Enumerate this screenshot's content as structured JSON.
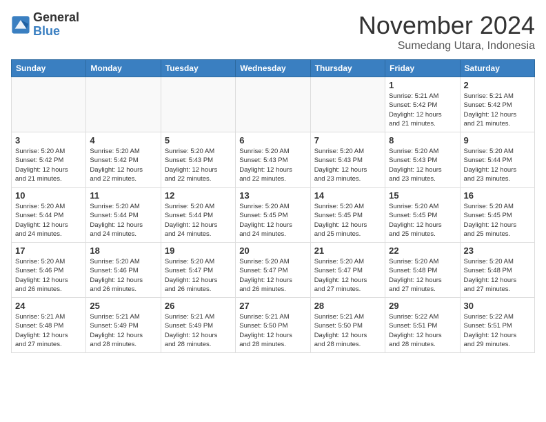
{
  "header": {
    "logo_line1": "General",
    "logo_line2": "Blue",
    "month": "November 2024",
    "location": "Sumedang Utara, Indonesia"
  },
  "days_of_week": [
    "Sunday",
    "Monday",
    "Tuesday",
    "Wednesday",
    "Thursday",
    "Friday",
    "Saturday"
  ],
  "weeks": [
    [
      {
        "day": "",
        "info": ""
      },
      {
        "day": "",
        "info": ""
      },
      {
        "day": "",
        "info": ""
      },
      {
        "day": "",
        "info": ""
      },
      {
        "day": "",
        "info": ""
      },
      {
        "day": "1",
        "info": "Sunrise: 5:21 AM\nSunset: 5:42 PM\nDaylight: 12 hours\nand 21 minutes."
      },
      {
        "day": "2",
        "info": "Sunrise: 5:21 AM\nSunset: 5:42 PM\nDaylight: 12 hours\nand 21 minutes."
      }
    ],
    [
      {
        "day": "3",
        "info": "Sunrise: 5:20 AM\nSunset: 5:42 PM\nDaylight: 12 hours\nand 21 minutes."
      },
      {
        "day": "4",
        "info": "Sunrise: 5:20 AM\nSunset: 5:42 PM\nDaylight: 12 hours\nand 22 minutes."
      },
      {
        "day": "5",
        "info": "Sunrise: 5:20 AM\nSunset: 5:43 PM\nDaylight: 12 hours\nand 22 minutes."
      },
      {
        "day": "6",
        "info": "Sunrise: 5:20 AM\nSunset: 5:43 PM\nDaylight: 12 hours\nand 22 minutes."
      },
      {
        "day": "7",
        "info": "Sunrise: 5:20 AM\nSunset: 5:43 PM\nDaylight: 12 hours\nand 23 minutes."
      },
      {
        "day": "8",
        "info": "Sunrise: 5:20 AM\nSunset: 5:43 PM\nDaylight: 12 hours\nand 23 minutes."
      },
      {
        "day": "9",
        "info": "Sunrise: 5:20 AM\nSunset: 5:44 PM\nDaylight: 12 hours\nand 23 minutes."
      }
    ],
    [
      {
        "day": "10",
        "info": "Sunrise: 5:20 AM\nSunset: 5:44 PM\nDaylight: 12 hours\nand 24 minutes."
      },
      {
        "day": "11",
        "info": "Sunrise: 5:20 AM\nSunset: 5:44 PM\nDaylight: 12 hours\nand 24 minutes."
      },
      {
        "day": "12",
        "info": "Sunrise: 5:20 AM\nSunset: 5:44 PM\nDaylight: 12 hours\nand 24 minutes."
      },
      {
        "day": "13",
        "info": "Sunrise: 5:20 AM\nSunset: 5:45 PM\nDaylight: 12 hours\nand 24 minutes."
      },
      {
        "day": "14",
        "info": "Sunrise: 5:20 AM\nSunset: 5:45 PM\nDaylight: 12 hours\nand 25 minutes."
      },
      {
        "day": "15",
        "info": "Sunrise: 5:20 AM\nSunset: 5:45 PM\nDaylight: 12 hours\nand 25 minutes."
      },
      {
        "day": "16",
        "info": "Sunrise: 5:20 AM\nSunset: 5:45 PM\nDaylight: 12 hours\nand 25 minutes."
      }
    ],
    [
      {
        "day": "17",
        "info": "Sunrise: 5:20 AM\nSunset: 5:46 PM\nDaylight: 12 hours\nand 26 minutes."
      },
      {
        "day": "18",
        "info": "Sunrise: 5:20 AM\nSunset: 5:46 PM\nDaylight: 12 hours\nand 26 minutes."
      },
      {
        "day": "19",
        "info": "Sunrise: 5:20 AM\nSunset: 5:47 PM\nDaylight: 12 hours\nand 26 minutes."
      },
      {
        "day": "20",
        "info": "Sunrise: 5:20 AM\nSunset: 5:47 PM\nDaylight: 12 hours\nand 26 minutes."
      },
      {
        "day": "21",
        "info": "Sunrise: 5:20 AM\nSunset: 5:47 PM\nDaylight: 12 hours\nand 27 minutes."
      },
      {
        "day": "22",
        "info": "Sunrise: 5:20 AM\nSunset: 5:48 PM\nDaylight: 12 hours\nand 27 minutes."
      },
      {
        "day": "23",
        "info": "Sunrise: 5:20 AM\nSunset: 5:48 PM\nDaylight: 12 hours\nand 27 minutes."
      }
    ],
    [
      {
        "day": "24",
        "info": "Sunrise: 5:21 AM\nSunset: 5:48 PM\nDaylight: 12 hours\nand 27 minutes."
      },
      {
        "day": "25",
        "info": "Sunrise: 5:21 AM\nSunset: 5:49 PM\nDaylight: 12 hours\nand 28 minutes."
      },
      {
        "day": "26",
        "info": "Sunrise: 5:21 AM\nSunset: 5:49 PM\nDaylight: 12 hours\nand 28 minutes."
      },
      {
        "day": "27",
        "info": "Sunrise: 5:21 AM\nSunset: 5:50 PM\nDaylight: 12 hours\nand 28 minutes."
      },
      {
        "day": "28",
        "info": "Sunrise: 5:21 AM\nSunset: 5:50 PM\nDaylight: 12 hours\nand 28 minutes."
      },
      {
        "day": "29",
        "info": "Sunrise: 5:22 AM\nSunset: 5:51 PM\nDaylight: 12 hours\nand 28 minutes."
      },
      {
        "day": "30",
        "info": "Sunrise: 5:22 AM\nSunset: 5:51 PM\nDaylight: 12 hours\nand 29 minutes."
      }
    ]
  ]
}
